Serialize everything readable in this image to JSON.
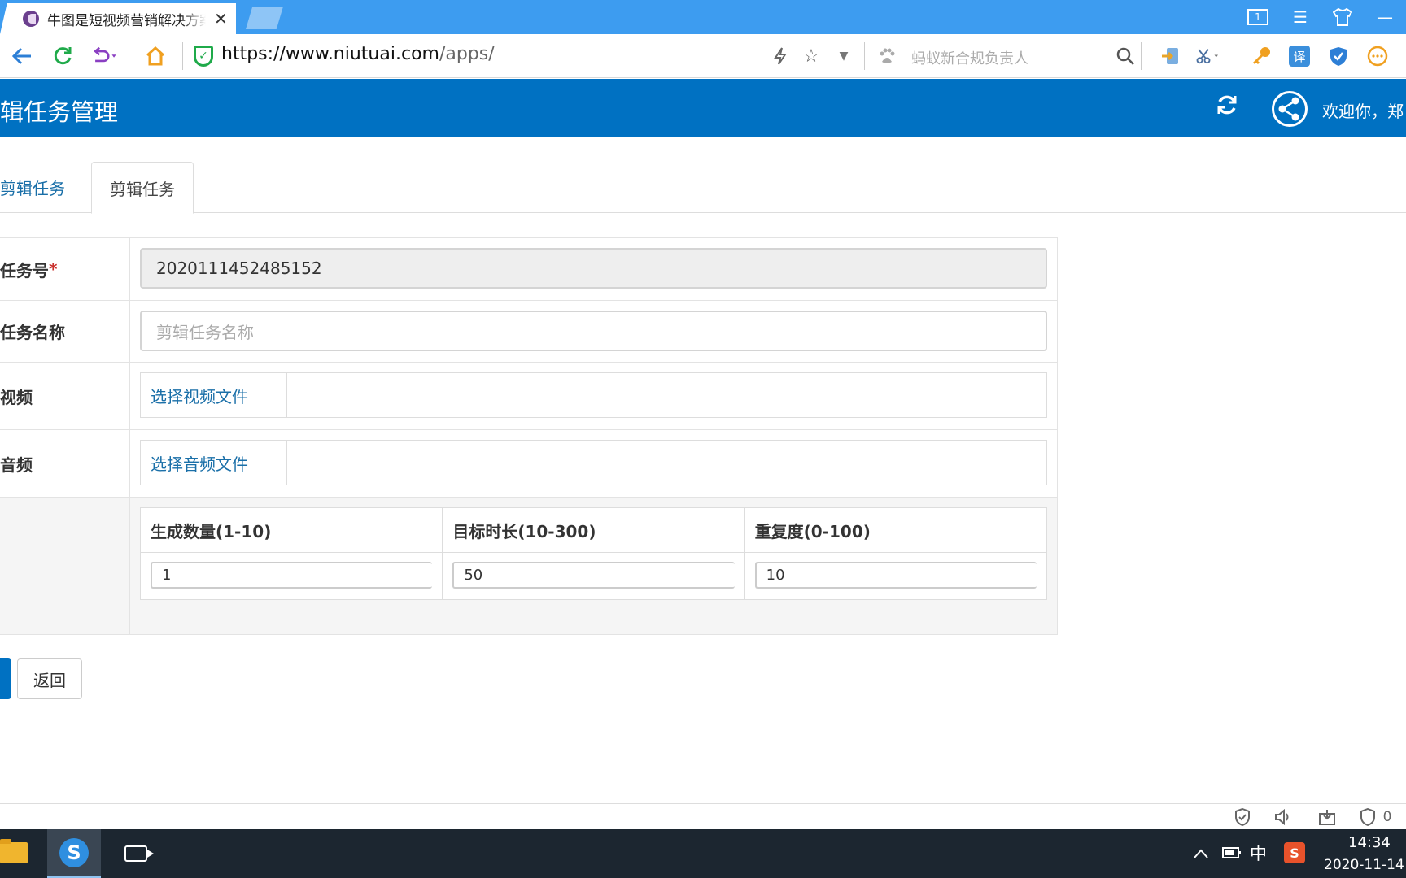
{
  "browser": {
    "tab_title": "牛图是短视频营销解决方案",
    "tab_close": "✕",
    "window_counter": "1",
    "url_main": "https://www.niutuai.com",
    "url_path": "/apps/",
    "search_placeholder": "蚂蚁新合规负责人"
  },
  "app": {
    "title": "辑任务管理",
    "welcome": "欢迎你，郑"
  },
  "tabs": [
    {
      "label": "剪辑任务",
      "active": false
    },
    {
      "label": "剪辑任务",
      "active": true
    }
  ],
  "form": {
    "task_no": {
      "label": "任务号",
      "required_mark": "*",
      "value": "2020111452485152"
    },
    "task_name": {
      "label": "任务名称",
      "placeholder": "剪辑任务名称"
    },
    "video": {
      "label": "视频",
      "button": "选择视频文件"
    },
    "audio": {
      "label": "音频",
      "button": "选择音频文件"
    },
    "params": {
      "headers": [
        "生成数量(1-10)",
        "目标时长(10-300)",
        "重复度(0-100)"
      ],
      "values": [
        "1",
        "50",
        "10"
      ]
    }
  },
  "actions": {
    "back": "返回"
  },
  "statusbar": {
    "ad_count": "0"
  },
  "taskbar": {
    "ime_lang": "中",
    "ime_logo": "S",
    "time": "14:34",
    "date": "2020-11-14"
  },
  "colors": {
    "tabbar": "#3d9cf0",
    "app_header": "#0071c2",
    "link": "#1a6fa8",
    "required": "#c9302c",
    "taskbar": "#1c2630"
  }
}
